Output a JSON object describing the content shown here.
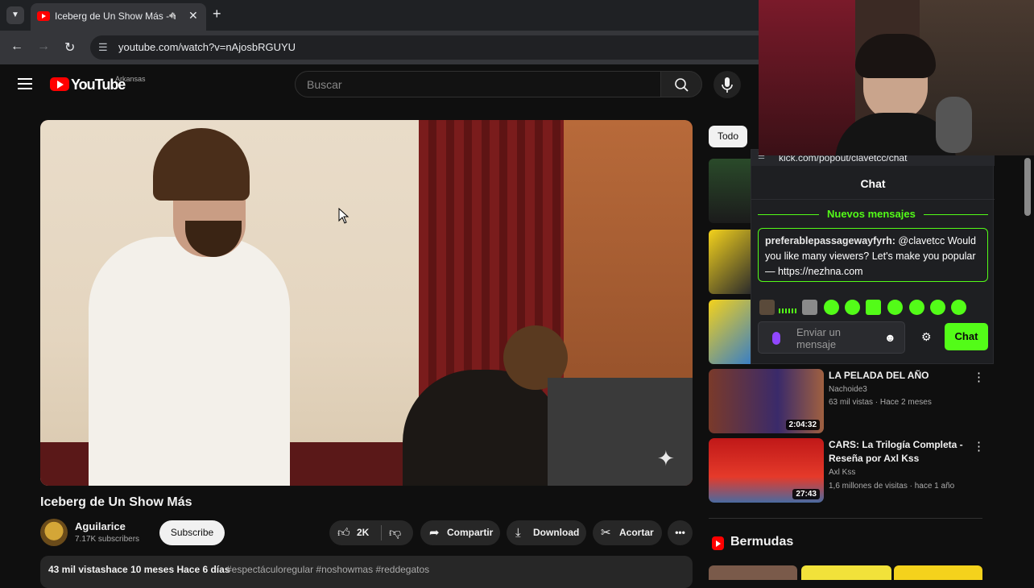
{
  "browser": {
    "tab_title": "Iceberg de Un Show Más - YouTube",
    "url": "youtube.com/watch?v=nAjosbRGUYU"
  },
  "youtube": {
    "logo_text": "YouTube",
    "country": "Arkansas",
    "search_placeholder": "Buscar"
  },
  "video": {
    "title": "Iceberg de Un Show Más",
    "channel": "Aguilarice",
    "subscribers": "7.17K subscribers",
    "subscribe_label": "Subscribe",
    "likes": "2K",
    "share_label": "Compartir",
    "download_label": "Download",
    "clip_label": "Acortar",
    "description_views": "43 mil vistashace 10 meses  Hace 6 días",
    "description_tags": "#espectáculoregular #noshowmas #reddegatos"
  },
  "sidebar": {
    "chip_all": "Todo",
    "recommendations": [
      {
        "title": "LA PELADA DEL AÑO",
        "channel": "Nachoide3",
        "meta": "63 mil vistas · Hace 2 meses",
        "duration": "2:04:32"
      },
      {
        "title": "CARS: La Trilogía Completa - Reseña por Axl Kss",
        "channel": "Axl Kss",
        "meta": "1,6 millones de visitas · hace 1 año",
        "duration": "27:43"
      }
    ],
    "shorts_title": "Bermudas"
  },
  "kick_chat": {
    "url": "kick.com/popout/clavetcc/chat",
    "header": "Chat",
    "new_messages": "Nuevos mensajes",
    "message_user": "preferablepassagewayfyrh:",
    "message_text": "@clavetcc Would you like many viewers? Let's make you popular — https://nezhna.com",
    "input_placeholder": "Enviar un mensaje",
    "send_label": "Chat"
  },
  "colors": {
    "youtube_red": "#ff0000",
    "kick_green": "#53fc18",
    "background": "#0f0f0f"
  }
}
